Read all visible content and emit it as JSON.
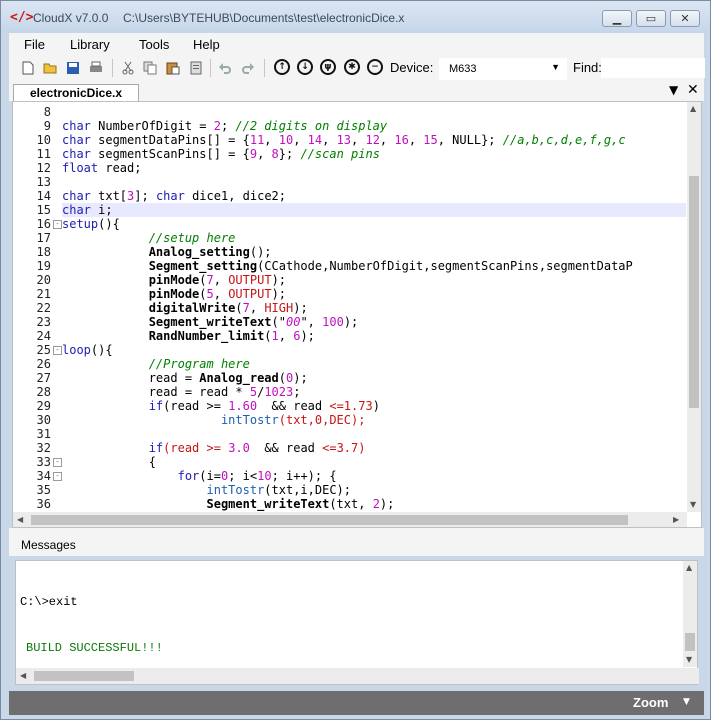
{
  "window": {
    "logo_text": "</>",
    "app_title": "CloudX v7.0.0",
    "file_path": "C:\\Users\\BYTEHUB\\Documents\\test\\electronicDice.x"
  },
  "menu": [
    "File",
    "Library",
    "Tools",
    "Help"
  ],
  "toolbar": {
    "icons": [
      "new-file-icon",
      "open-folder-icon",
      "save-icon",
      "print-icon",
      "cut-icon",
      "copy-icon",
      "paste-icon",
      "clipboard-icon",
      "undo-icon",
      "redo-icon",
      "upload-icon",
      "download-icon",
      "usb-icon",
      "debug-icon",
      "stop-icon"
    ],
    "device_label": "Device:",
    "device_value": "M633",
    "find_label": "Find:"
  },
  "tab": {
    "label": "electronicDice.x"
  },
  "editor": {
    "highlighted_line": 15,
    "lines": [
      {
        "n": "8",
        "segs": []
      },
      {
        "n": "9",
        "segs": [
          [
            "kw",
            "char "
          ],
          [
            "",
            "NumberOfDigit = "
          ],
          [
            "num",
            "2"
          ],
          [
            "",
            "; "
          ],
          [
            "cm",
            "//2 digits on display"
          ]
        ]
      },
      {
        "n": "10",
        "segs": [
          [
            "kw",
            "char "
          ],
          [
            "",
            "segmentDataPins[] = {"
          ],
          [
            "num",
            "11"
          ],
          [
            "",
            ", "
          ],
          [
            "num",
            "10"
          ],
          [
            "",
            ", "
          ],
          [
            "num",
            "14"
          ],
          [
            "",
            ", "
          ],
          [
            "num",
            "13"
          ],
          [
            "",
            ", "
          ],
          [
            "num",
            "12"
          ],
          [
            "",
            ", "
          ],
          [
            "num",
            "16"
          ],
          [
            "",
            ", "
          ],
          [
            "num",
            "15"
          ],
          [
            "",
            ", NULL}; "
          ],
          [
            "cm",
            "//a,b,c,d,e,f,g,c"
          ]
        ]
      },
      {
        "n": "11",
        "segs": [
          [
            "kw",
            "char "
          ],
          [
            "",
            "segmentScanPins[] = {"
          ],
          [
            "num",
            "9"
          ],
          [
            "",
            ", "
          ],
          [
            "num",
            "8"
          ],
          [
            "",
            "}; "
          ],
          [
            "cm",
            "//scan pins"
          ]
        ]
      },
      {
        "n": "12",
        "segs": [
          [
            "kw",
            "float "
          ],
          [
            "",
            "read;"
          ]
        ]
      },
      {
        "n": "13",
        "segs": []
      },
      {
        "n": "14",
        "segs": [
          [
            "kw",
            "char "
          ],
          [
            "",
            "txt["
          ],
          [
            "num",
            "3"
          ],
          [
            "",
            "]; "
          ],
          [
            "kw",
            "char "
          ],
          [
            "",
            "dice1, dice2;"
          ]
        ]
      },
      {
        "n": "15",
        "segs": [
          [
            "kw",
            "char "
          ],
          [
            "",
            "i;"
          ]
        ]
      },
      {
        "n": "16",
        "fold": "-",
        "segs": [
          [
            "kw",
            "setup"
          ],
          [
            "",
            "(){"
          ]
        ]
      },
      {
        "n": "17",
        "segs": [
          [
            "",
            "            "
          ],
          [
            "cm",
            "//setup here"
          ]
        ]
      },
      {
        "n": "18",
        "segs": [
          [
            "",
            "            "
          ],
          [
            "fn",
            "Analog_setting"
          ],
          [
            "",
            "();"
          ]
        ]
      },
      {
        "n": "19",
        "segs": [
          [
            "",
            "            "
          ],
          [
            "fn",
            "Segment_setting"
          ],
          [
            "",
            "(CCathode,NumberOfDigit,segmentScanPins,segmentDataP"
          ]
        ]
      },
      {
        "n": "20",
        "segs": [
          [
            "",
            "            "
          ],
          [
            "fn",
            "pinMode"
          ],
          [
            "",
            "("
          ],
          [
            "num",
            "7"
          ],
          [
            "",
            ", "
          ],
          [
            "red",
            "OUTPUT"
          ],
          [
            "",
            "); "
          ]
        ]
      },
      {
        "n": "21",
        "segs": [
          [
            "",
            "            "
          ],
          [
            "fn",
            "pinMode"
          ],
          [
            "",
            "("
          ],
          [
            "num",
            "5"
          ],
          [
            "",
            ", "
          ],
          [
            "red",
            "OUTPUT"
          ],
          [
            "",
            "); "
          ]
        ]
      },
      {
        "n": "22",
        "segs": [
          [
            "",
            "            "
          ],
          [
            "fn",
            "digitalWrite"
          ],
          [
            "",
            "("
          ],
          [
            "num",
            "7"
          ],
          [
            "",
            ", "
          ],
          [
            "red",
            "HIGH"
          ],
          [
            "",
            "); "
          ]
        ]
      },
      {
        "n": "23",
        "segs": [
          [
            "",
            "            "
          ],
          [
            "fn",
            "Segment_writeText"
          ],
          [
            "",
            "(\""
          ],
          [
            "str",
            "00"
          ],
          [
            "",
            "\", "
          ],
          [
            "num",
            "100"
          ],
          [
            "",
            "); "
          ]
        ]
      },
      {
        "n": "24",
        "segs": [
          [
            "",
            "            "
          ],
          [
            "fn",
            "RandNumber_limit"
          ],
          [
            "",
            "("
          ],
          [
            "num",
            "1"
          ],
          [
            "",
            ", "
          ],
          [
            "num",
            "6"
          ],
          [
            "",
            "); "
          ]
        ]
      },
      {
        "n": "25",
        "fold": "-",
        "segs": [
          [
            "kw",
            "loop"
          ],
          [
            "",
            "(){"
          ]
        ]
      },
      {
        "n": "26",
        "segs": [
          [
            "",
            "            "
          ],
          [
            "cm",
            "//Program here"
          ]
        ]
      },
      {
        "n": "27",
        "segs": [
          [
            "",
            "            read = "
          ],
          [
            "fn",
            "Analog_read"
          ],
          [
            "",
            "("
          ],
          [
            "num",
            "0"
          ],
          [
            "",
            "); "
          ]
        ]
      },
      {
        "n": "28",
        "segs": [
          [
            "",
            "            read = read * "
          ],
          [
            "num",
            "5"
          ],
          [
            "",
            "/"
          ],
          [
            "num",
            "1023"
          ],
          [
            "",
            ";"
          ]
        ]
      },
      {
        "n": "29",
        "segs": [
          [
            "",
            "            "
          ],
          [
            "kw",
            "if"
          ],
          [
            "",
            "(read >= "
          ],
          [
            "num",
            "1.60"
          ],
          [
            "",
            ""
          ],
          [
            "",
            ""
          ],
          [
            "",
            "  && read "
          ],
          [
            "red",
            "<=1.73"
          ],
          [
            "",
            ")"
          ]
        ]
      },
      {
        "n": "30",
        "segs": [
          [
            "",
            "                      "
          ],
          [
            "lib",
            "intTostr"
          ],
          [
            "red",
            "(txt,0,DEC);"
          ]
        ]
      },
      {
        "n": "31",
        "segs": []
      },
      {
        "n": "32",
        "segs": [
          [
            "",
            "            "
          ],
          [
            "kw",
            "if"
          ],
          [
            "red",
            "(read >= "
          ],
          [
            "num",
            "3.0"
          ],
          [
            "",
            ""
          ],
          [
            "",
            ""
          ],
          [
            "",
            "  && read "
          ],
          [
            "red",
            "<=3.7)"
          ]
        ]
      },
      {
        "n": "33",
        "fold": "-",
        "segs": [
          [
            "",
            "            {"
          ]
        ]
      },
      {
        "n": "34",
        "fold": "-",
        "segs": [
          [
            "",
            "                "
          ],
          [
            "kw",
            "for"
          ],
          [
            "",
            "(i="
          ],
          [
            "num",
            "0"
          ],
          [
            "",
            "; i<"
          ],
          [
            "num",
            "10"
          ],
          [
            "",
            "; i++); {"
          ]
        ]
      },
      {
        "n": "35",
        "segs": [
          [
            "",
            "                    "
          ],
          [
            "lib",
            "intTostr"
          ],
          [
            "",
            "(txt,i,DEC);"
          ]
        ]
      },
      {
        "n": "36",
        "segs": [
          [
            "",
            "                    "
          ],
          [
            "fn",
            "Segment_writeText"
          ],
          [
            "",
            "(txt, "
          ],
          [
            "num",
            "2"
          ],
          [
            "",
            ");"
          ]
        ]
      }
    ]
  },
  "messages": {
    "title": "Messages",
    "lines": [
      "C:\\>exit",
      "BUILD SUCCESSFUL!!!"
    ]
  },
  "status": {
    "zoom_label": "Zoom"
  },
  "colors": {
    "keyword": "#2020b0",
    "number": "#c010c0",
    "comment": "#008000",
    "success": "#0a7a0a",
    "highlight": "#e8e8ff"
  }
}
